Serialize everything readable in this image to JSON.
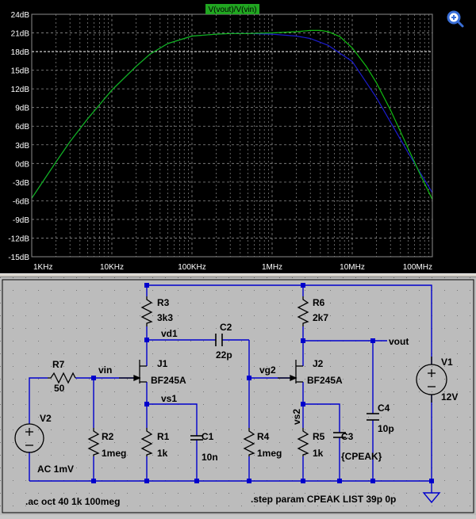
{
  "plot": {
    "trace_label": "V(vout)/V(vin)",
    "magnifier_icon": "zoom-magnifier-icon",
    "colors": {
      "background": "#000000",
      "grid": "#8c8c8c",
      "axis_text": "#ffffff",
      "trace_39p": "#1c1ccc",
      "trace_0p": "#11bb11",
      "label_bg": "#21a621"
    }
  },
  "chart_data": {
    "type": "line",
    "x_scale": "log",
    "xlim": [
      1000,
      100000000
    ],
    "ylim": [
      -15,
      24
    ],
    "grid": true,
    "xticks": [
      {
        "v": 1000,
        "label": "1KHz"
      },
      {
        "v": 10000,
        "label": "10KHz"
      },
      {
        "v": 100000,
        "label": "100KHz"
      },
      {
        "v": 1000000,
        "label": "1MHz"
      },
      {
        "v": 10000000,
        "label": "10MHz"
      },
      {
        "v": 100000000,
        "label": "100MHz"
      }
    ],
    "yticks": [
      {
        "v": 24,
        "label": "24dB"
      },
      {
        "v": 21,
        "label": "21dB"
      },
      {
        "v": 18,
        "label": "18dB"
      },
      {
        "v": 15,
        "label": "15dB"
      },
      {
        "v": 12,
        "label": "12dB"
      },
      {
        "v": 9,
        "label": "9dB"
      },
      {
        "v": 6,
        "label": "6dB"
      },
      {
        "v": 3,
        "label": "3dB"
      },
      {
        "v": 0,
        "label": "0dB"
      },
      {
        "v": -3,
        "label": "-3dB"
      },
      {
        "v": -6,
        "label": "-6dB"
      },
      {
        "v": -9,
        "label": "-9dB"
      },
      {
        "v": -12,
        "label": "-12dB"
      },
      {
        "v": -15,
        "label": "-15dB"
      }
    ],
    "series": [
      {
        "color": "#1c1ccc",
        "x": [
          1000,
          2000,
          3000,
          5000,
          10000,
          20000,
          30000,
          50000,
          100000,
          200000,
          300000,
          500000,
          1000000,
          2000000,
          3000000,
          5000000,
          10000000,
          20000000,
          50000000,
          100000000
        ],
        "y": [
          -5.6,
          0.2,
          3.5,
          7.2,
          11.8,
          15.6,
          17.6,
          19.3,
          20.5,
          20.8,
          20.9,
          20.9,
          20.8,
          20.5,
          20.1,
          19.0,
          16.4,
          10.6,
          1.7,
          -4.7
        ]
      },
      {
        "color": "#11bb11",
        "x": [
          1000,
          2000,
          3000,
          5000,
          10000,
          20000,
          30000,
          50000,
          100000,
          200000,
          300000,
          500000,
          1000000,
          2000000,
          3000000,
          4000000,
          5000000,
          7000000,
          10000000,
          15000000,
          20000000,
          30000000,
          50000000,
          70000000,
          100000000
        ],
        "y": [
          -5.6,
          0.2,
          3.5,
          7.2,
          11.8,
          15.6,
          17.6,
          19.3,
          20.5,
          20.8,
          20.9,
          20.9,
          21.0,
          21.2,
          21.4,
          21.4,
          21.2,
          20.4,
          18.6,
          15.6,
          13.0,
          8.6,
          2.4,
          -1.7,
          -5.8
        ]
      }
    ]
  },
  "schematic": {
    "colors": {
      "wire": "#0000cc",
      "text": "#000000",
      "junction": "#0000cc",
      "ground": "#0000cc"
    },
    "components": {
      "R1": {
        "name": "R1",
        "value": "1k"
      },
      "R2": {
        "name": "R2",
        "value": "1meg"
      },
      "R3": {
        "name": "R3",
        "value": "3k3"
      },
      "R4": {
        "name": "R4",
        "value": "1meg"
      },
      "R5": {
        "name": "R5",
        "value": "1k"
      },
      "R6": {
        "name": "R6",
        "value": "2k7"
      },
      "R7": {
        "name": "R7",
        "value": "50"
      },
      "C1": {
        "name": "C1",
        "value": "10n"
      },
      "C2": {
        "name": "C2",
        "value": "22p"
      },
      "C3": {
        "name": "C3",
        "value": "{CPEAK}"
      },
      "C4": {
        "name": "C4",
        "value": "10p"
      },
      "J1": {
        "name": "J1",
        "value": "BF245A"
      },
      "J2": {
        "name": "J2",
        "value": "BF245A"
      },
      "V1": {
        "name": "V1",
        "value": "12V"
      },
      "V2": {
        "name": "V2",
        "value": "AC 1mV"
      }
    },
    "nets": {
      "vin": "vin",
      "vd1": "vd1",
      "vs1": "vs1",
      "vg2": "vg2",
      "vs2": "vs2",
      "vout": "vout"
    },
    "directives": {
      "ac": ".ac oct 40 1k 100meg",
      "step": ".step param CPEAK LIST 39p 0p"
    }
  }
}
